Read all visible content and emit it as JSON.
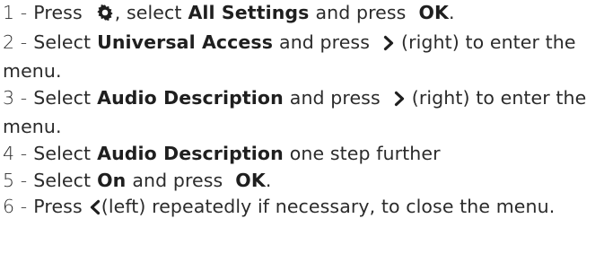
{
  "steps": [
    {
      "num": "1 -",
      "t1": "Press",
      "icon": "gear-icon",
      "t2": ", select",
      "ui1": "All Settings",
      "t3": "and press",
      "ui2": "OK",
      "t4": "."
    },
    {
      "num": "2 -",
      "t1": "Select",
      "ui1": "Universal Access",
      "t2": "and press",
      "icon": "chevron-right-icon",
      "t3": "(right) to enter the menu."
    },
    {
      "num": "3 -",
      "t1": "Select",
      "ui1": "Audio Description",
      "t2": "and press",
      "icon": "chevron-right-icon",
      "t3": "(right) to enter the menu."
    },
    {
      "num": "4 -",
      "t1": "Select",
      "ui1": "Audio Description",
      "t2": "one step further"
    },
    {
      "num": "5 -",
      "t1": "Select",
      "ui1": "On",
      "t2": "and press",
      "ui2": "OK",
      "t3": "."
    },
    {
      "num": "6 -",
      "t1": "Press",
      "icon": "chevron-left-icon",
      "t2": "(left) repeatedly if necessary, to close the menu."
    }
  ]
}
